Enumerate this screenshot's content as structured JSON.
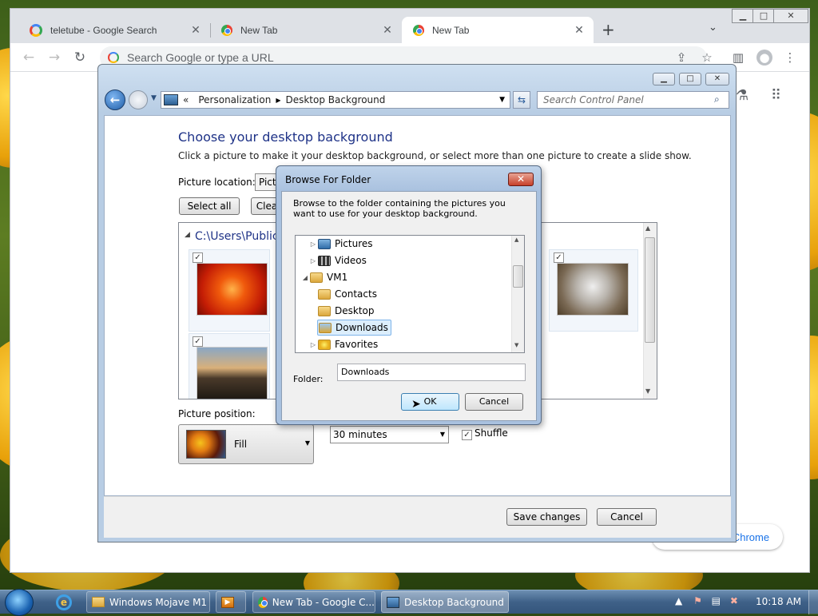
{
  "chrome": {
    "tabs": [
      {
        "title": "teletube - Google Search"
      },
      {
        "title": "New Tab"
      },
      {
        "title": "New Tab"
      }
    ],
    "new_tab_icon": "plus-icon",
    "omnibox_placeholder": "Search Google or type a URL",
    "customize_label": "Customize Chrome"
  },
  "control_panel": {
    "breadcrumb": [
      "Personalization",
      "Desktop Background"
    ],
    "search_placeholder": "Search Control Panel",
    "heading": "Choose your desktop background",
    "description": "Click a picture to make it your desktop background, or select more than one picture to create a slide show.",
    "picture_location_label": "Picture location:",
    "picture_location_value": "Pictu",
    "select_all": "Select all",
    "clear_all": "Clea",
    "group_path": "C:\\Users\\Public\\",
    "picture_position_label": "Picture position:",
    "position_value": "Fill",
    "interval_value": "30 minutes",
    "shuffle_label": "Shuffle",
    "shuffle_checked": true,
    "save_changes": "Save changes",
    "cancel": "Cancel"
  },
  "browse_dialog": {
    "title": "Browse For Folder",
    "close": "✕",
    "instruction": "Browse to the folder containing the pictures you want to use for your desktop background.",
    "tree": [
      {
        "label": "Pictures",
        "level": 1,
        "expander": "closed"
      },
      {
        "label": "Videos",
        "level": 1,
        "expander": "closed"
      },
      {
        "label": "VM1",
        "level": 0,
        "expander": "open"
      },
      {
        "label": "Contacts",
        "level": 1,
        "expander": "none"
      },
      {
        "label": "Desktop",
        "level": 1,
        "expander": "none"
      },
      {
        "label": "Downloads",
        "level": 1,
        "expander": "none",
        "selected": true
      },
      {
        "label": "Favorites",
        "level": 1,
        "expander": "closed"
      }
    ],
    "folder_label": "Folder:",
    "folder_value": "Downloads",
    "ok": "OK",
    "cancel": "Cancel"
  },
  "taskbar": {
    "buttons": [
      {
        "label": "Windows Mojave M1"
      },
      {
        "label": ""
      },
      {
        "label": "New Tab - Google C..."
      },
      {
        "label": "Desktop Background",
        "active": true
      }
    ],
    "clock": "10:18 AM"
  }
}
